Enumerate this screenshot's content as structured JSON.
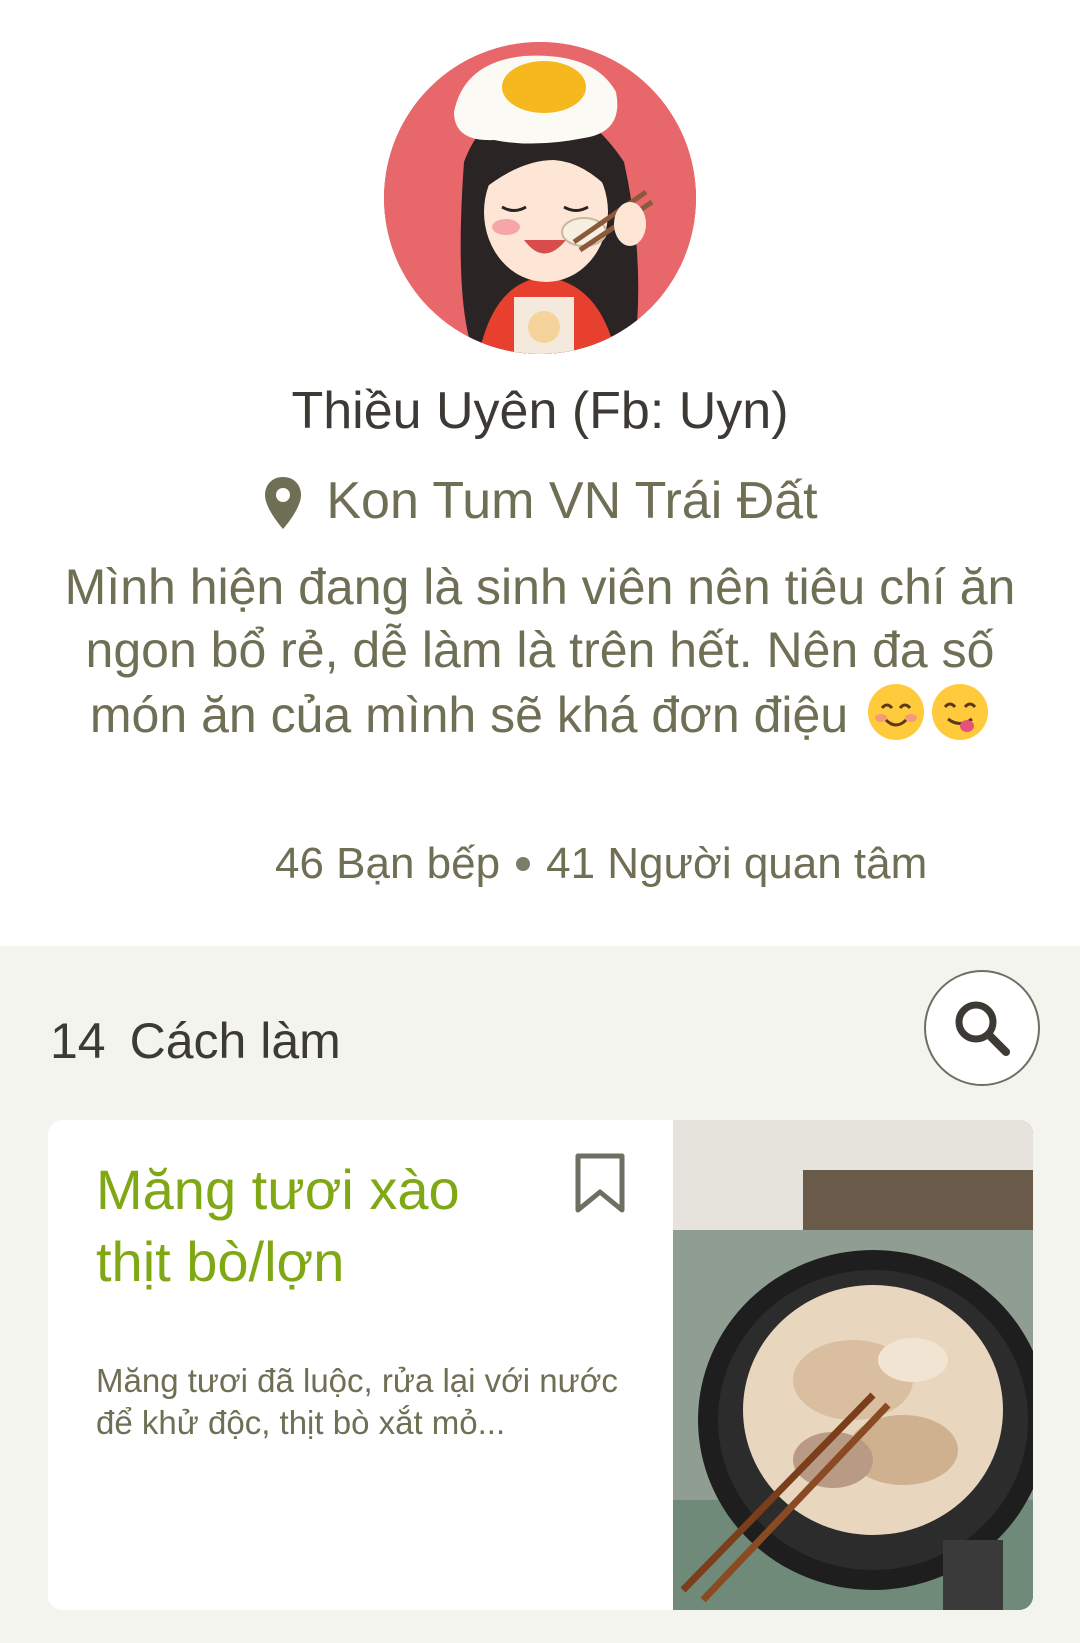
{
  "profile": {
    "name": "Thiều Uyên (Fb: Uyn)",
    "location": "Kon Tum VN Trái Đất",
    "bio": "Mình hiện đang là sinh viên nên tiêu chí ăn ngon bổ rẻ, dễ làm là trên hết. Nên đa số món ăn của mình sẽ khá đơn điệu",
    "bio_emojis": [
      "smiling-face-icon",
      "face-savoring-food-icon"
    ],
    "friends_label": "46 Bạn bếp",
    "followers_label": "41 Người quan tâm"
  },
  "recipes": {
    "count": "14",
    "label": "Cách làm",
    "items": [
      {
        "title": "Măng tươi xào thịt bò/lợn",
        "description": "Măng tươi đã luộc, rửa lại với nước để khử độc, thịt bò xắt mỏ..."
      }
    ]
  },
  "colors": {
    "accent_title": "#7fa814",
    "text_muted": "#6f6f55",
    "text_dark": "#3d3a35",
    "section_bg": "#f4f4ef",
    "avatar_bg": "#e8676a"
  }
}
